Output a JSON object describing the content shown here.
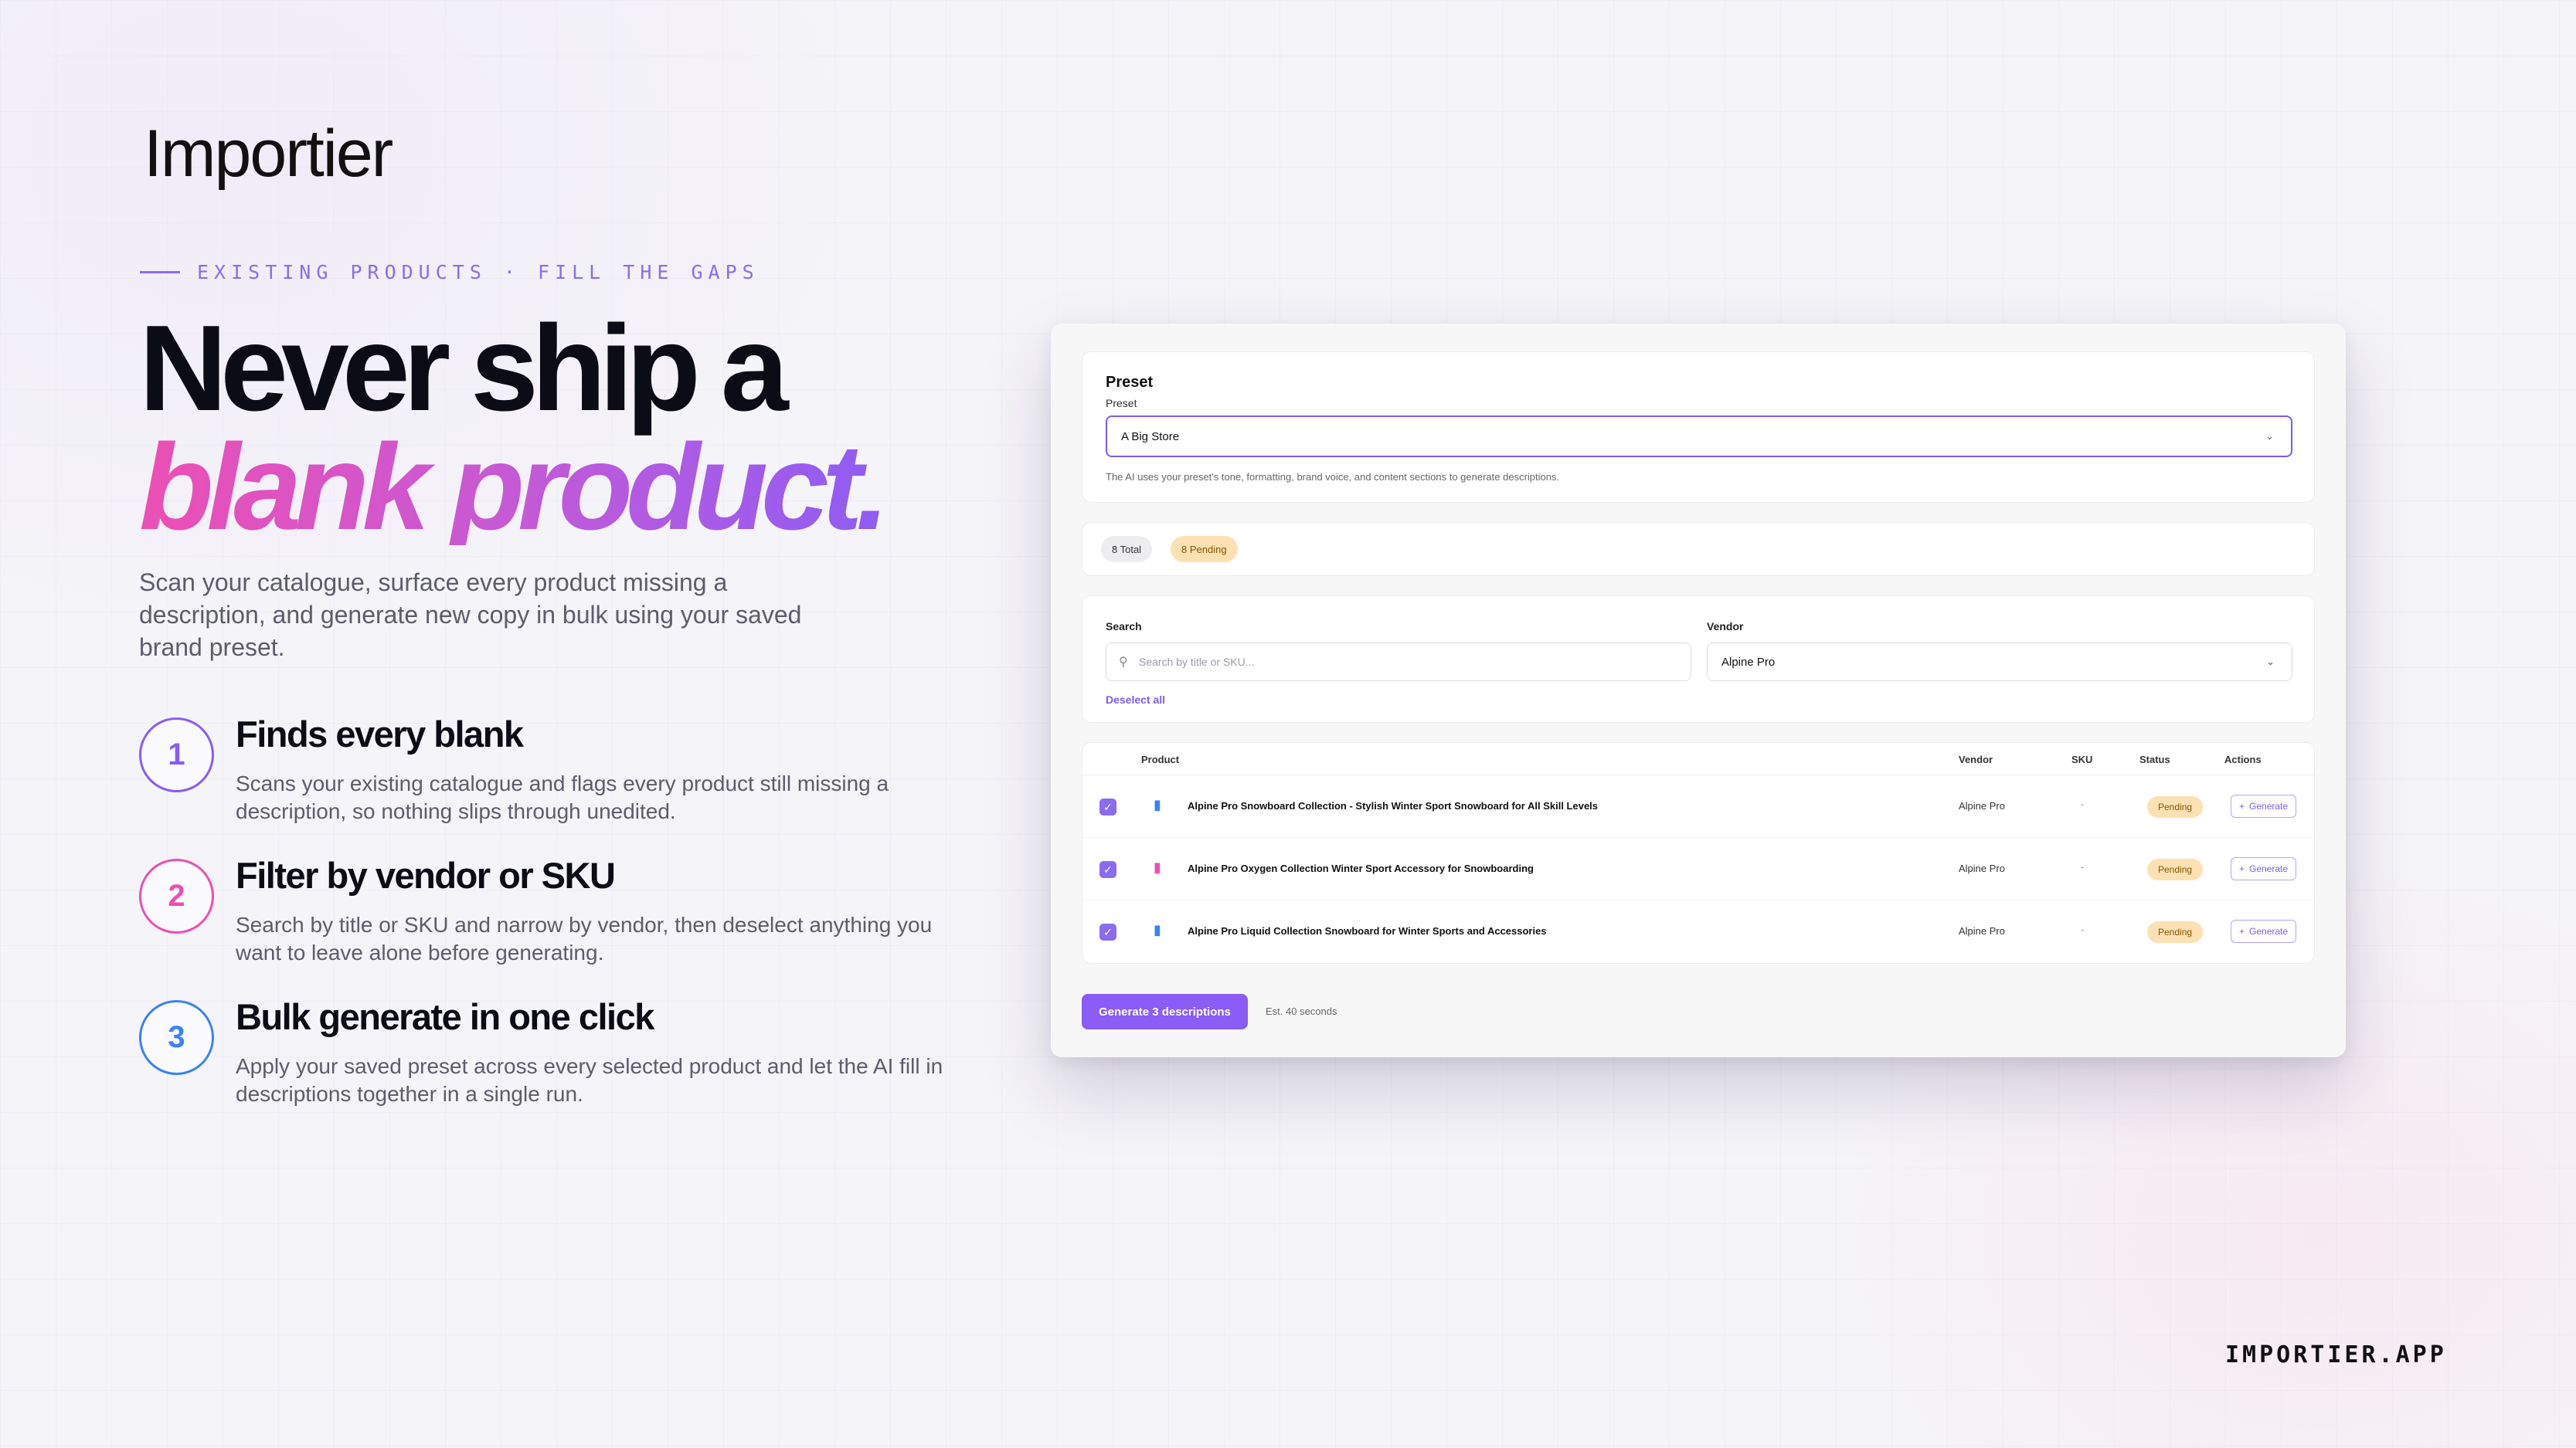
{
  "brand": {
    "logo": "Importier",
    "footer": "IMPORTIER.APP"
  },
  "eyebrow": "EXISTING PRODUCTS · FILL THE GAPS",
  "headline": {
    "line1": "Never ship a",
    "line2": "blank product."
  },
  "intro": "Scan your catalogue, surface every product missing a description, and generate new copy in bulk using your saved brand preset.",
  "steps": [
    {
      "num": "1",
      "title": "Finds every blank",
      "desc": "Scans your existing catalogue and flags every product still missing a description, so nothing slips through unedited.",
      "color": "#8b5cf6"
    },
    {
      "num": "2",
      "title": "Filter by vendor or SKU",
      "desc": "Search by title or SKU and narrow by vendor, then deselect anything you want to leave alone before generating.",
      "color": "#ec4fb4"
    },
    {
      "num": "3",
      "title": "Bulk generate in one click",
      "desc": "Apply your saved preset across every selected product and let the AI fill in descriptions together in a single run.",
      "color": "#3b82f6"
    }
  ],
  "app": {
    "preset": {
      "heading": "Preset",
      "label": "Preset",
      "value": "A Big Store",
      "help": "The AI uses your preset's tone, formatting, brand voice, and content sections to generate descriptions."
    },
    "counts": {
      "total": "8 Total",
      "pending": "8 Pending"
    },
    "filters": {
      "search_label": "Search",
      "search_placeholder": "Search by title or SKU...",
      "vendor_label": "Vendor",
      "vendor_value": "Alpine Pro",
      "deselect": "Deselect all"
    },
    "table": {
      "headers": {
        "product": "Product",
        "vendor": "Vendor",
        "sku": "SKU",
        "status": "Status",
        "actions": "Actions"
      },
      "rows": [
        {
          "title": "Alpine Pro Snowboard Collection - Stylish Winter Sport Snowboard for All Skill Levels",
          "vendor": "Alpine Pro",
          "sku": "-",
          "status": "Pending",
          "action": "Generate",
          "icon_color": "#3b82f6"
        },
        {
          "title": "Alpine Pro Oxygen Collection Winter Sport Accessory for Snowboarding",
          "vendor": "Alpine Pro",
          "sku": "-",
          "status": "Pending",
          "action": "Generate",
          "icon_color": "#ec4fb4"
        },
        {
          "title": "Alpine Pro Liquid Collection Snowboard for Winter Sports and Accessories",
          "vendor": "Alpine Pro",
          "sku": "-",
          "status": "Pending",
          "action": "Generate",
          "icon_color": "#3b82f6"
        }
      ]
    },
    "generate_button": "Generate 3 descriptions",
    "estimate": "Est. 40 seconds"
  }
}
